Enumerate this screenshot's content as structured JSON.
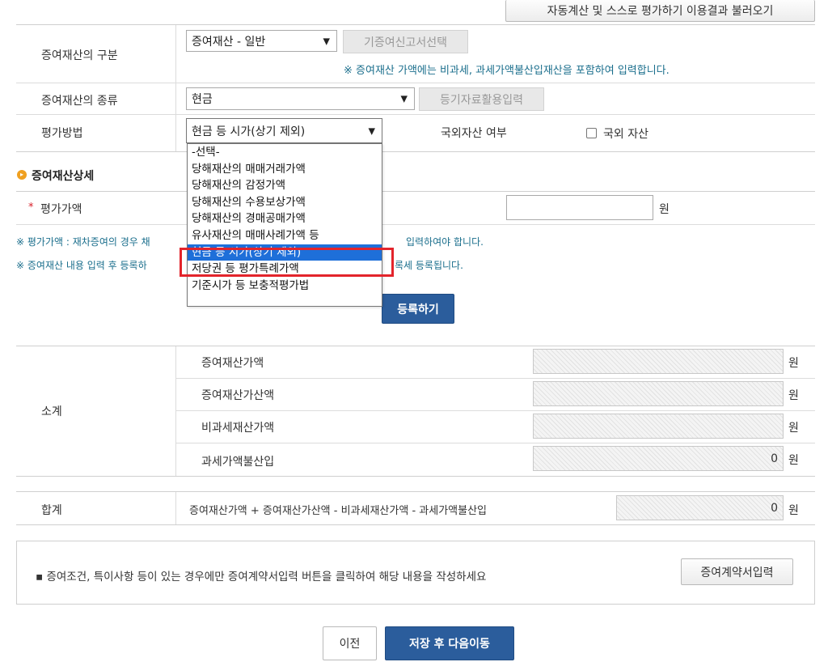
{
  "top_button": "자동계산 및 스스로 평가하기 이용결과 불러오기",
  "form": {
    "category_label": "증여재산의 구분",
    "category_value": "증여재산 - 일반",
    "prev_report_button": "기증여신고서선택",
    "category_note": "※ 증여재산 가액에는 비과세, 과세가액불산입재산을 포함하여 입력합니다.",
    "type_label": "증여재산의 종류",
    "type_value": "현금",
    "registry_button": "등기자료활용입력",
    "method_label": "평가방법",
    "method_value": "현금 등 시가(상기 제외)",
    "foreign_label": "국외자산 여부",
    "foreign_checkbox_label": "국외 자산"
  },
  "detail": {
    "section_title": "증여재산상세",
    "required_mark": "*",
    "eval_label": "평가가액",
    "unit": "원",
    "note1_left": "※ 평가가액 : 재차증여의 경우 채",
    "note1_right": "입력하여야 합니다.",
    "note2_left": "※ 증여재산 내용 입력 후 등록하",
    "note2_right": "록세 등록됩니다.",
    "register_button": "등록하기"
  },
  "dropdown": {
    "options": [
      "-선택-",
      "당해재산의 매매거래가액",
      "당해재산의 감정가액",
      "당해재산의 수용보상가액",
      "당해재산의 경매공매가액",
      "유사재산의 매매사례가액 등",
      "현금 등 시가(상기 제외)",
      "저당권 등 평가특례가액",
      "기준시가 등 보충적평가법"
    ],
    "selected_index": 6
  },
  "subtotal": {
    "label": "소계",
    "rows": [
      {
        "label": "증여재산가액",
        "value": "",
        "unit": "원"
      },
      {
        "label": "증여재산가산액",
        "value": "",
        "unit": "원"
      },
      {
        "label": "비과세재산가액",
        "value": "",
        "unit": "원"
      },
      {
        "label": "과세가액불산입",
        "value": "0",
        "unit": "원"
      }
    ]
  },
  "total": {
    "label": "합계",
    "formula": "증여재산가액 + 증여재산가산액 - 비과세재산가액 - 과세가액불산입",
    "value": "0",
    "unit": "원"
  },
  "contract": {
    "note": "▪ 증여조건, 특이사항 등이 있는 경우에만 증여계약서입력 버튼을 클릭하여 해당 내용을 작성하세요",
    "button": "증여계약서입력"
  },
  "footer": {
    "prev_button": "이전",
    "save_button": "저장 후 다음이동"
  },
  "colors": {
    "primary_blue": "#2b5d9c",
    "note_teal": "#1a6e8c",
    "highlight_red": "#e3242b",
    "selected_option": "#1e6fd9",
    "section_bullet": "#f0a020"
  }
}
